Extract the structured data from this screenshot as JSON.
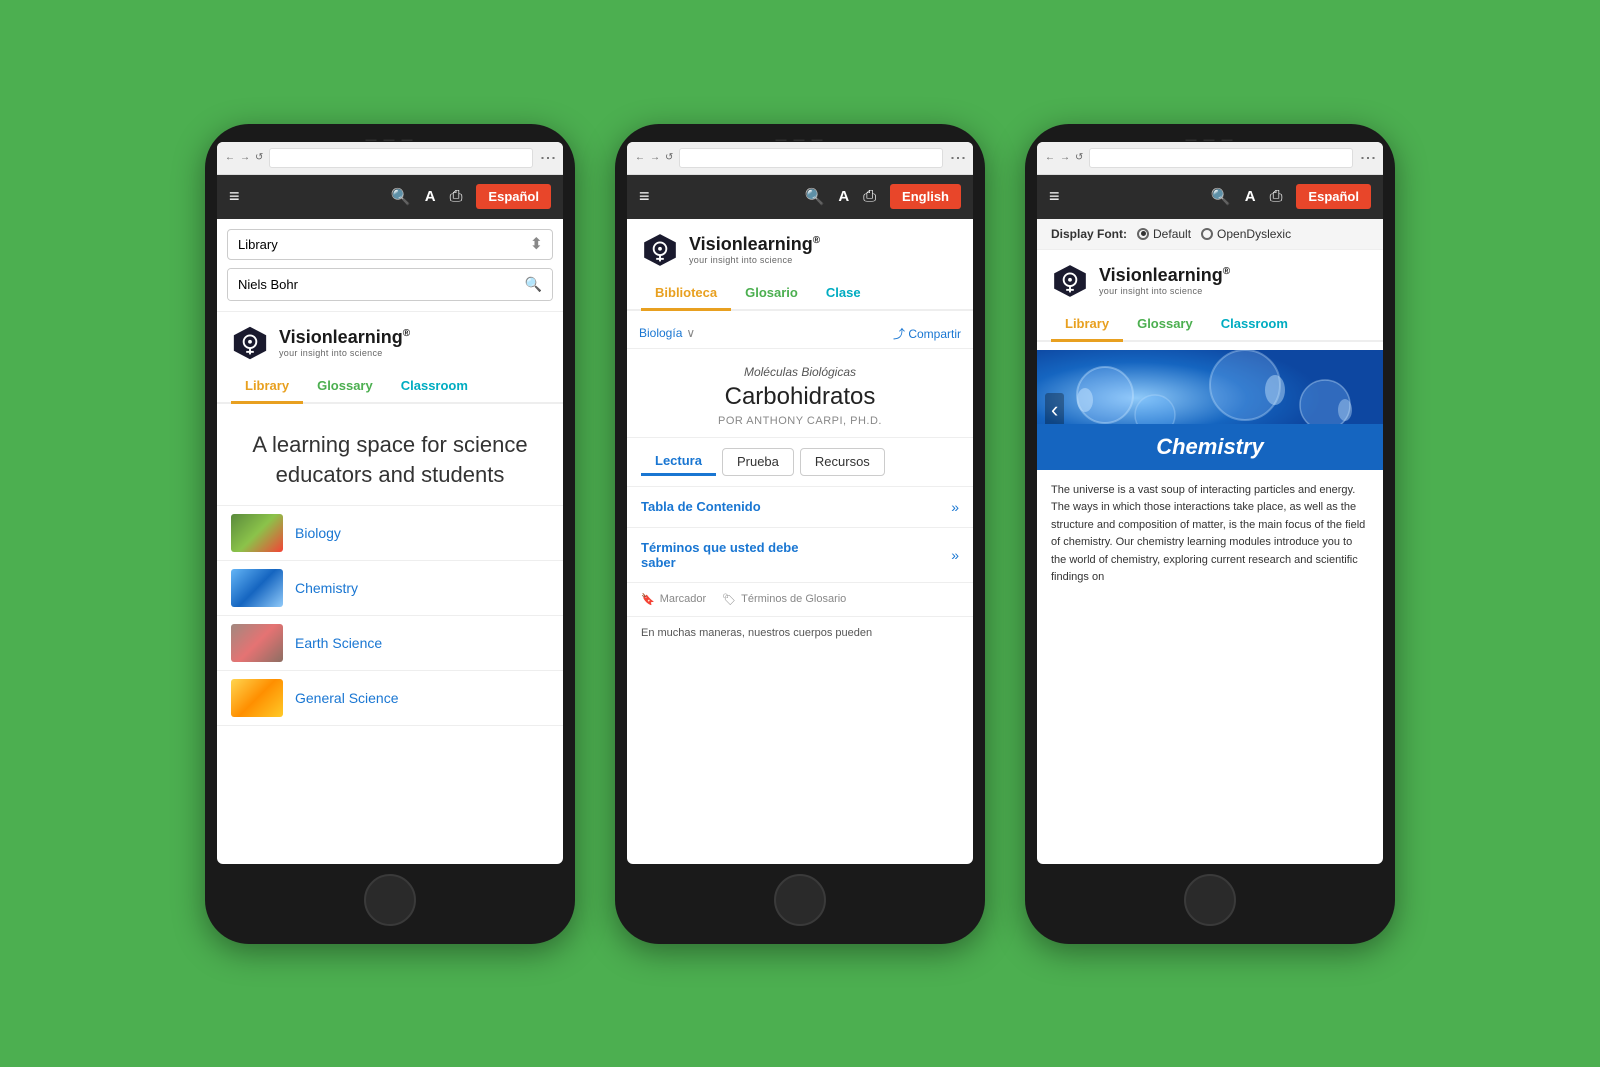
{
  "background_color": "#4caf50",
  "phones": [
    {
      "id": "phone1",
      "browser": {
        "back": "←",
        "forward": "→",
        "refresh": "↺"
      },
      "navbar": {
        "hamburger": "≡",
        "search_icon": "🔍",
        "font_icon": "A",
        "print_icon": "🖨",
        "lang_button": "Español"
      },
      "search": {
        "select_value": "Library",
        "select_arrow": "⬍",
        "input_value": "Niels Bohr",
        "search_icon": "🔍"
      },
      "logo": {
        "name": "Visionlearning",
        "registered": "®",
        "tagline": "your insight into science"
      },
      "tabs": [
        {
          "label": "Library",
          "state": "active"
        },
        {
          "label": "Glossary",
          "state": "inactive"
        },
        {
          "label": "Classroom",
          "state": "inactive"
        }
      ],
      "tagline": "A learning space for science educators and students",
      "subjects": [
        {
          "name": "Biology",
          "thumb_class": "biology"
        },
        {
          "name": "Chemistry",
          "thumb_class": "chemistry"
        },
        {
          "name": "Earth Science",
          "thumb_class": "earth"
        },
        {
          "name": "General Science",
          "thumb_class": "general"
        }
      ]
    },
    {
      "id": "phone2",
      "browser": {
        "back": "←",
        "forward": "→",
        "refresh": "↺"
      },
      "navbar": {
        "hamburger": "≡",
        "search_icon": "🔍",
        "font_icon": "A",
        "print_icon": "🖨",
        "lang_button": "English"
      },
      "logo": {
        "name": "Visionlearning",
        "registered": "®",
        "tagline": "your insight into science"
      },
      "tabs": [
        {
          "label": "Biblioteca",
          "state": "active"
        },
        {
          "label": "Glosario",
          "state": "inactive"
        },
        {
          "label": "Clase",
          "state": "inactive"
        }
      ],
      "breadcrumb": "Biología",
      "share_label": "⤴ Compartir",
      "article": {
        "category": "Moléculas Biológicas",
        "title": "Carbohidratos",
        "author": "POR ANTHONY CARPI, PH.D."
      },
      "article_tabs": [
        {
          "label": "Lectura",
          "state": "active"
        },
        {
          "label": "Prueba",
          "state": "inactive"
        },
        {
          "label": "Recursos",
          "state": "inactive"
        }
      ],
      "accordion": [
        {
          "title": "Tabla de Contenido",
          "arrow": "≫"
        },
        {
          "title": "Términos que usted debe saber",
          "arrow": "≫"
        }
      ],
      "tools": [
        {
          "icon": "🔖",
          "label": "Marcador"
        },
        {
          "icon": "🏷",
          "label": "Términos de Glosario"
        }
      ],
      "preview_text": "En muchas maneras, nuestros cuerpos pueden"
    },
    {
      "id": "phone3",
      "browser": {
        "back": "←",
        "forward": "→",
        "refresh": "↺"
      },
      "navbar": {
        "hamburger": "≡",
        "search_icon": "🔍",
        "font_icon": "A",
        "print_icon": "🖨",
        "lang_button": "Español"
      },
      "font_option": {
        "label": "Display Font:",
        "options": [
          {
            "label": "Default",
            "selected": true
          },
          {
            "label": "OpenDyslexic",
            "selected": false
          }
        ]
      },
      "logo": {
        "name": "Visionlearning",
        "registered": "®",
        "tagline": "your insight into science"
      },
      "tabs": [
        {
          "label": "Library",
          "state": "active"
        },
        {
          "label": "Glossary",
          "state": "inactive"
        },
        {
          "label": "Classroom",
          "state": "inactive"
        }
      ],
      "chemistry": {
        "banner_title": "Chemistry",
        "description": "The universe is a vast soup of interacting particles and energy. The ways in which those interactions take place, as well as the structure and composition of matter, is the main focus of the field of chemistry. Our chemistry learning modules introduce you to the world of chemistry, exploring current research and scientific findings on"
      }
    }
  ]
}
